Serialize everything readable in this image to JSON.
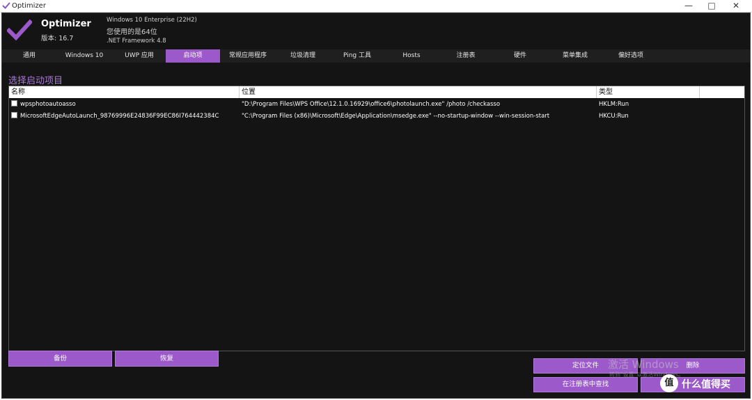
{
  "window": {
    "title": "Optimizer",
    "minimize_glyph": "—",
    "maximize_glyph": "□",
    "close_glyph": "✕"
  },
  "header": {
    "app_name": "Optimizer",
    "version": "版本: 16.7",
    "os": "Windows 10 Enterprise (22H2)",
    "arch": "您使用的是64位",
    "framework": ".NET Framework 4.8"
  },
  "tabs": [
    {
      "label": "通用"
    },
    {
      "label": "Windows 10"
    },
    {
      "label": "UWP 应用"
    },
    {
      "label": "启动项"
    },
    {
      "label": "常规应用程序"
    },
    {
      "label": "垃圾清理"
    },
    {
      "label": "Ping 工具"
    },
    {
      "label": "Hosts"
    },
    {
      "label": "注册表"
    },
    {
      "label": "硬件"
    },
    {
      "label": "菜单集成"
    },
    {
      "label": "偏好选项"
    }
  ],
  "active_tab": "启动项",
  "startup": {
    "section_title": "选择启动项目",
    "columns": {
      "name": "名称",
      "location": "位置",
      "type": "类型"
    },
    "rows": [
      {
        "checked": false,
        "name": "wpsphotoautoasso",
        "location": "\"D:\\Program Files\\WPS Office\\12.1.0.16929\\office6\\photolaunch.exe\" /photo /checkasso",
        "type": "HKLM:Run"
      },
      {
        "checked": false,
        "name": "MicrosoftEdgeAutoLaunch_98769996E24836F99EC86I764442384C",
        "location": "\"C:\\Program Files (x86)\\Microsoft\\Edge\\Application\\msedge.exe\" --no-startup-window --win-session-start",
        "type": "HKCU:Run"
      }
    ]
  },
  "buttons": {
    "backup": "备份",
    "restore": "恢复",
    "locate_file": "定位文件",
    "delete": "删除",
    "find_in_registry": "在注册表中查找"
  },
  "watermark": {
    "activate": "激活 Windows",
    "activate_sub": "转到\"设置\"以激活Windows。",
    "site_badge": "值",
    "site_name": "什么值得买"
  },
  "colors": {
    "accent": "#9b59c9",
    "background": "#141414",
    "section_title": "#a77ad6"
  }
}
